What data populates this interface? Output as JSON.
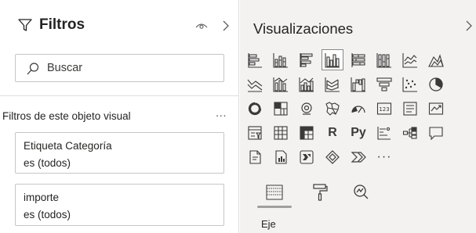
{
  "filters_pane": {
    "title": "Filtros",
    "icons": {
      "title": "funnel-icon",
      "visibility": "eye-icon",
      "collapse": "chevron-right-icon"
    },
    "search": {
      "placeholder": "Buscar",
      "value": "",
      "icon": "search-icon"
    },
    "section": {
      "title": "Filtros de este objeto visual",
      "more": "..."
    },
    "cards": [
      {
        "name": "Etiqueta Categoría",
        "value": "es (todos)"
      },
      {
        "name": "importe",
        "value": "es (todos)"
      }
    ]
  },
  "viz_pane": {
    "title": "Visualizaciones",
    "collapse_icon": "chevron-right-icon",
    "selected_visual": "clustered-column-chart",
    "visuals": [
      "stacked-bar-chart",
      "stacked-column-chart",
      "clustered-bar-chart",
      "clustered-column-chart",
      "100-stacked-bar-chart",
      "100-stacked-column-chart",
      "line-chart",
      "area-chart",
      "stacked-area-chart",
      "line-and-stacked-column-chart",
      "line-and-clustered-column-chart",
      "ribbon-chart",
      "waterfall-chart",
      "funnel-chart",
      "scatter-chart",
      "pie-chart",
      "donut-chart",
      "treemap",
      "map",
      "filled-map",
      "gauge",
      "card",
      "multi-row-card",
      "kpi",
      "slicer",
      "table",
      "matrix",
      "r-script-visual",
      "python-visual",
      "key-influencers",
      "decomposition-tree",
      "qa-visual",
      "paginated-report",
      "power-apps",
      "power-automate",
      "smart-narrative",
      "more-visuals"
    ],
    "r_label": "R",
    "py_label": "Py",
    "more_label": "···",
    "tabs": [
      "fields-tab",
      "format-tab",
      "analytics-tab"
    ],
    "active_tab": "fields-tab",
    "section_label": "Eje"
  },
  "colors": {
    "accent_border": "#8a8886",
    "pane_bg": "#f3f2f1",
    "text": "#252423",
    "icon": "#3b3a39"
  }
}
